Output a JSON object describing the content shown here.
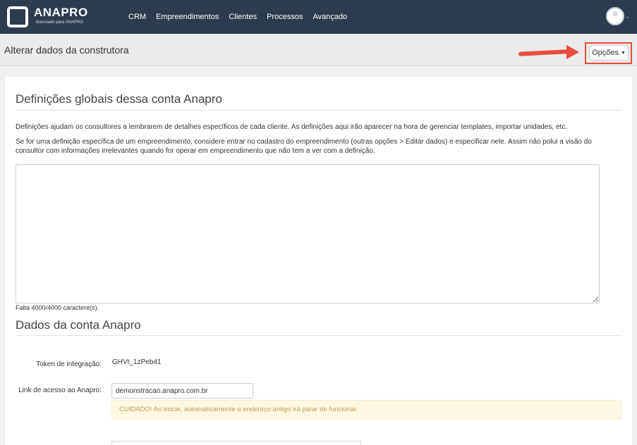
{
  "brand": {
    "name": "ANAPRO",
    "tagline": "licenciado para ANAPRO"
  },
  "nav": [
    "CRM",
    "Empreendimentos",
    "Clientes",
    "Processos",
    "Avançado"
  ],
  "header": {
    "title": "Alterar dados da construtora",
    "options_label": "Opções"
  },
  "definitions": {
    "heading": "Definições globais dessa conta Anapro",
    "text1": "Definições ajudam os consultores a lembrarem de detalhes específicos de cada cliente. As definições aqui irão aparecer na hora de gerenciar templates, importar unidades, etc.",
    "text2": "Se for uma definição específica de um empreendimento, considere entrar no cadastro do empreendimento (outras opções > Editar dados) e especificar nele. Assim não polui a visão do consultor com informações irrelevantes quando for operar em empreendimento que não tem a ver com a definição.",
    "textarea_value": "",
    "counter": "Falta 4000/4000 caractere(s)."
  },
  "account": {
    "heading": "Dados da conta Anapro",
    "token_label": "Token de integração:",
    "token_value": "GHVt_1zPeb41",
    "link_label": "Link de acesso ao Anapro:",
    "link_value": "demonstracao.anapro.com.br",
    "warning": "CUIDADO! Ao trocar, automaticamente o endereço antigo irá parar de funcionar.",
    "extra_value": ""
  },
  "colors": {
    "topbar": "#2d3b4e",
    "annotation": "#e74c3c",
    "warning_bg": "#fcf8e3",
    "warning_text": "#c09853"
  }
}
